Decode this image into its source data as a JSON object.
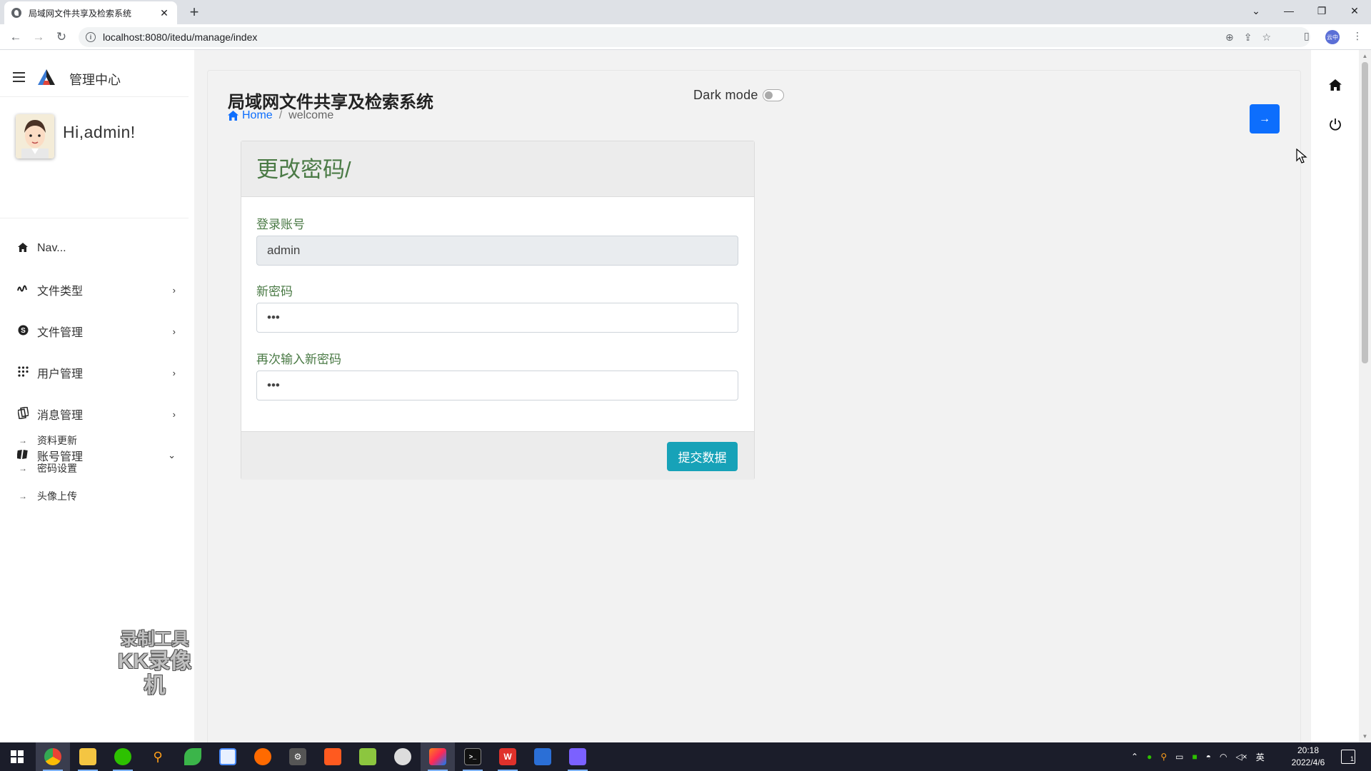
{
  "browser": {
    "tab_title": "局域网文件共享及检索系统",
    "url": "localhost:8080/itedu/manage/index",
    "profile_label": "云中"
  },
  "sidebar": {
    "brand": "管理中心",
    "greeting": "Hi,admin!",
    "items": [
      {
        "label": "Nav...",
        "icon": "home-icon",
        "chevron": ""
      },
      {
        "label": "文件类型",
        "icon": "wave-icon",
        "chevron": "›"
      },
      {
        "label": "文件管理",
        "icon": "skype-icon",
        "chevron": "›"
      },
      {
        "label": "用户管理",
        "icon": "grid-icon",
        "chevron": "›"
      },
      {
        "label": "消息管理",
        "icon": "copy-icon",
        "chevron": "›"
      },
      {
        "label": "账号管理",
        "icon": "book-icon",
        "chevron": "⌄"
      }
    ],
    "subitems": [
      {
        "label": "资料更新"
      },
      {
        "label": "密码设置"
      },
      {
        "label": "头像上传"
      }
    ]
  },
  "header": {
    "title": "局域网文件共享及检索系统",
    "breadcrumb_home": "Home",
    "breadcrumb_separator": "/",
    "breadcrumb_current": "welcome",
    "dark_mode_label": "Dark mode",
    "dark_mode_on": false,
    "next_button": "→"
  },
  "form": {
    "heading": "更改密码/",
    "account_label": "登录账号",
    "account_value": "admin",
    "new_password_label": "新密码",
    "new_password_value": "•••",
    "confirm_password_label": "再次输入新密码",
    "confirm_password_value": "•••",
    "submit_label": "提交数据"
  },
  "watermark": {
    "line1": "录制工具",
    "line2": "KK录像机"
  },
  "taskbar": {
    "clock_time": "20:18",
    "clock_date": "2022/4/6",
    "ime": "英",
    "notification_count": "1"
  },
  "colors": {
    "accent_blue": "#0d6efd",
    "form_green": "#4a7a45",
    "submit_teal": "#17a2b8"
  }
}
